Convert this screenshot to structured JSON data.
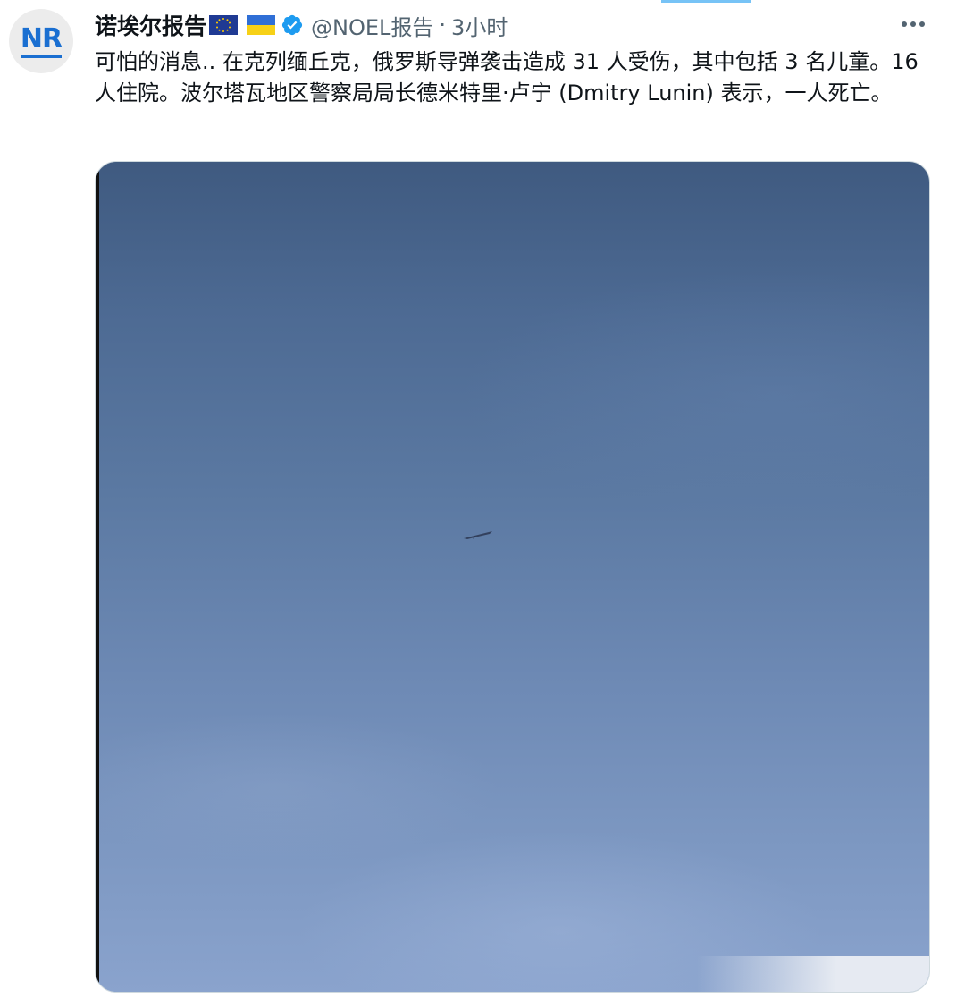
{
  "tweet": {
    "author": {
      "display_name": "诺埃尔报告",
      "handle": "@NOEL报告",
      "avatar_initials": "NR",
      "verified": true,
      "flags": [
        "eu-flag",
        "ukraine-flag"
      ]
    },
    "separator": "·",
    "timestamp": "3小时",
    "text": "可怕的消息.. 在克列缅丘克，俄罗斯导弹袭击造成 31 人受伤，其中包括 3 名儿童。16人住院。波尔塔瓦地区警察局局长德米特里·卢宁 (Dmitry Lunin) 表示，一人死亡。",
    "more_icon": "more-horizontal-icon"
  },
  "colors": {
    "accent": "#1d9bf0",
    "text": "#0f1419",
    "secondary_text": "#536471",
    "verified_badge": "#1d9bf0",
    "avatar_brand": "#1a6fd1"
  }
}
